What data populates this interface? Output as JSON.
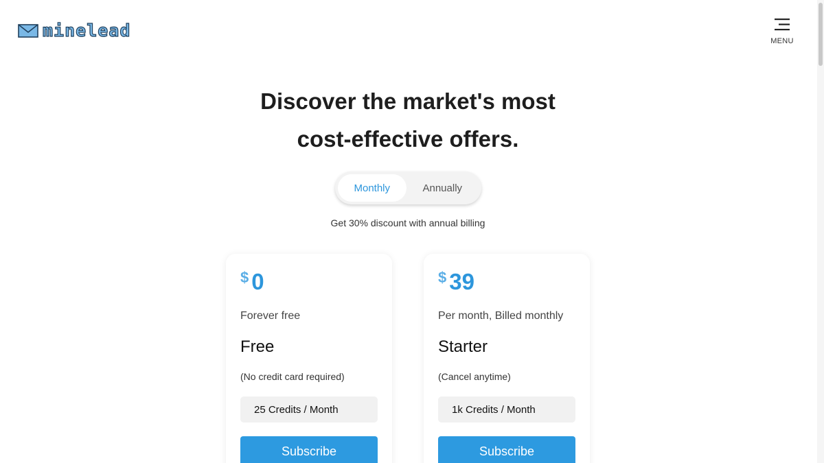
{
  "header": {
    "logo_text": "minelead",
    "menu_label": "MENU"
  },
  "hero": {
    "title_line1": "Discover the market's most",
    "title_line2": "cost-effective offers."
  },
  "billing_toggle": {
    "options": [
      "Monthly",
      "Annually"
    ],
    "selected": "Monthly",
    "discount_note": "Get 30% discount with annual billing"
  },
  "plans": [
    {
      "currency": "$",
      "price": "0",
      "period": "Forever free",
      "name": "Free",
      "note": "(No credit card required)",
      "credits": "25 Credits / Month",
      "cta": "Subscribe"
    },
    {
      "currency": "$",
      "price": "39",
      "period": "Per month, Billed monthly",
      "name": "Starter",
      "note": "(Cancel anytime)",
      "credits": "1k Credits / Month",
      "cta": "Subscribe"
    }
  ],
  "colors": {
    "accent": "#2d96dc",
    "button": "#2d9ae0",
    "credits_bg": "#f1f1f1"
  },
  "icons": {
    "logo": "envelope-icon",
    "menu": "hamburger-icon"
  }
}
